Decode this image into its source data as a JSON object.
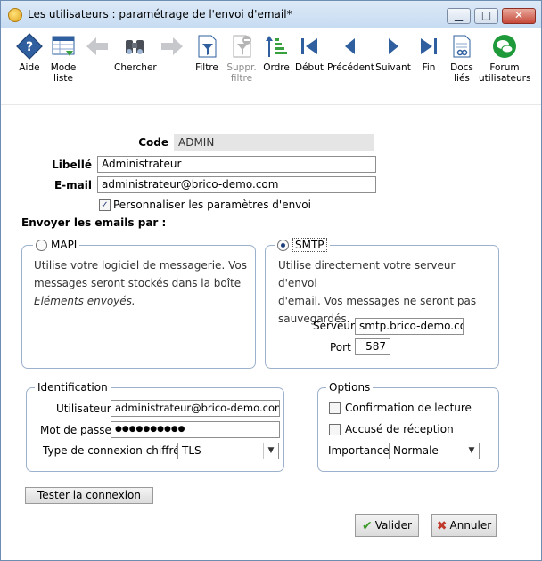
{
  "window": {
    "title": "Les utilisateurs : paramétrage de l'envoi d'email*",
    "min_glyph": "▁",
    "max_glyph": "□",
    "close_glyph": "✕"
  },
  "toolbar": {
    "help": "Aide",
    "list_mode": "Mode\nliste",
    "search": "Chercher",
    "filter": "Filtre",
    "remove_filter": "Suppr.\nfiltre",
    "order": "Ordre",
    "first": "Début",
    "previous": "Précédent",
    "next": "Suivant",
    "last": "Fin",
    "docs": "Docs\nliés",
    "forum": "Forum\nutilisateurs"
  },
  "form": {
    "code_label": "Code",
    "code_value": "ADMIN",
    "label_label": "Libellé",
    "label_value": "Administrateur",
    "email_label": "E-mail",
    "email_value": "administrateur@brico-demo.com",
    "custom_settings_label": "Personnaliser les paramètres d'envoi",
    "custom_settings_checked": "✓",
    "send_by_label": "Envoyer les emails par :"
  },
  "mapi": {
    "label": "MAPI",
    "desc_line1": "Utilise votre logiciel de messagerie. Vos",
    "desc_line2": "messages seront stockés dans la boîte",
    "desc_line3": "Eléments envoyés."
  },
  "smtp": {
    "label": "SMTP",
    "desc_line1": "Utilise directement votre serveur d'envoi",
    "desc_line2": "d'email. Vos messages ne seront pas",
    "desc_line3": "sauvegardés.",
    "server_label": "Serveur",
    "server_value": "smtp.brico-demo.com",
    "port_label": "Port",
    "port_value": "587"
  },
  "identification": {
    "title": "Identification",
    "user_label": "Utilisateur",
    "user_value": "administrateur@brico-demo.com",
    "password_label": "Mot de passe",
    "password_value": "●●●●●●●●●●",
    "conn_type_label": "Type de connexion chiffrée",
    "conn_type_value": "TLS"
  },
  "options": {
    "title": "Options",
    "read_receipt_label": "Confirmation de lecture",
    "delivery_receipt_label": "Accusé de réception",
    "importance_label": "Importance",
    "importance_value": "Normale"
  },
  "actions": {
    "test_connection": "Tester la connexion",
    "validate": "Valider",
    "validate_glyph": "✔",
    "cancel": "Annuler",
    "cancel_glyph": "✖"
  },
  "colors": {
    "toolbar_blue": "#2f5f9f",
    "forum_green": "#1f9a3a",
    "validate_green": "#3c9a2a",
    "cancel_red": "#c0392b"
  }
}
